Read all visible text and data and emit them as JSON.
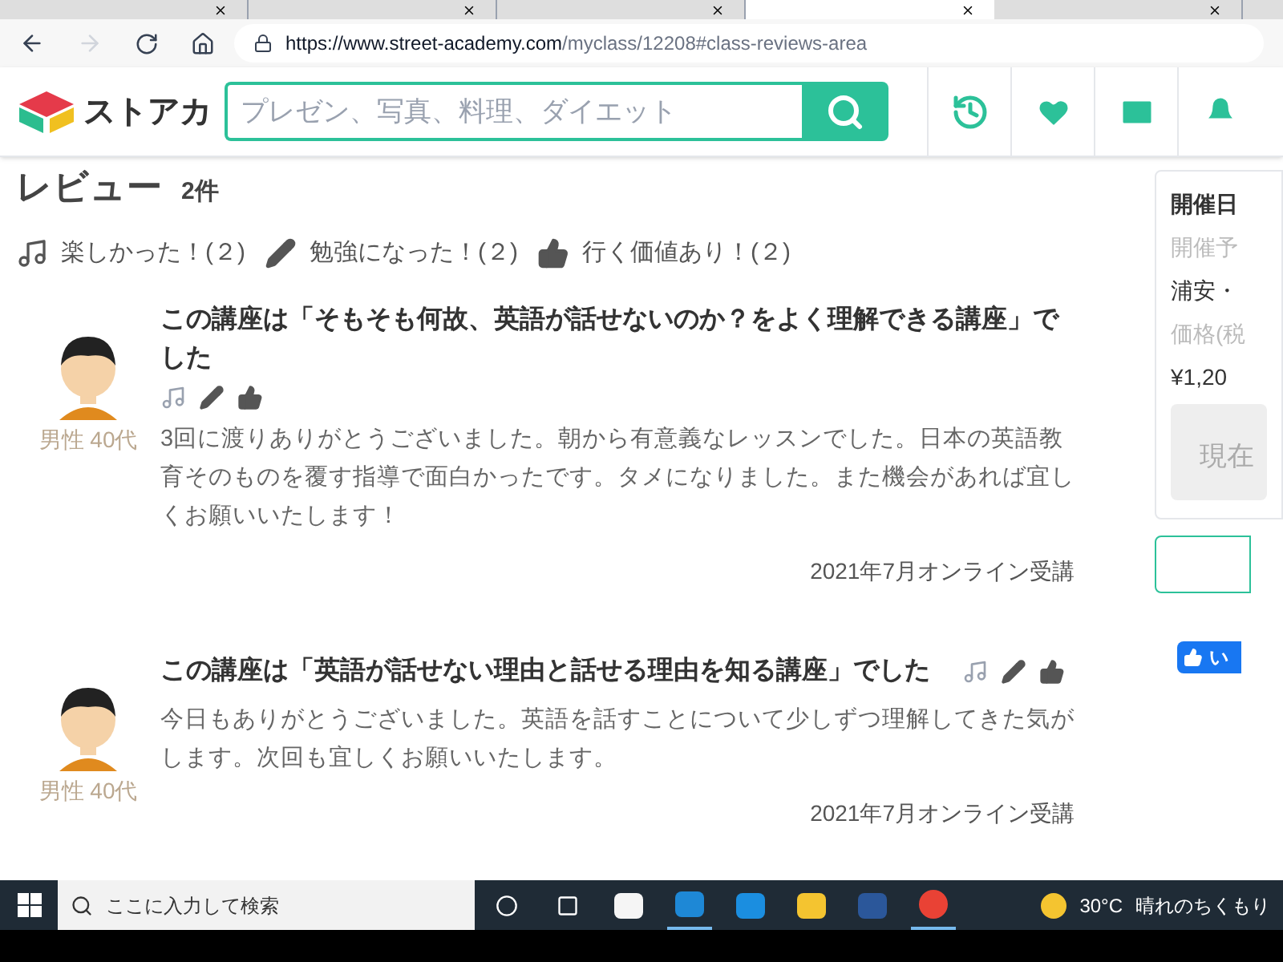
{
  "browser": {
    "tabs": [
      {
        "selected": false
      },
      {
        "selected": false
      },
      {
        "selected": false
      },
      {
        "selected": true
      },
      {
        "selected": false
      }
    ],
    "url_host": "https://www.street-academy.com",
    "url_path": "/myclass/12208#class-reviews-area"
  },
  "header": {
    "logo_text": "ストアカ",
    "search_placeholder": "プレゼン、写真、料理、ダイエット"
  },
  "reviews": {
    "title": "レビュー",
    "count": "2件",
    "summary": [
      {
        "kind": "music",
        "label": "楽しかった！(２)"
      },
      {
        "kind": "pencil",
        "label": "勉強になった！(２)"
      },
      {
        "kind": "thumb",
        "label": "行く価値あり！(２)"
      }
    ],
    "items": [
      {
        "reviewer": "男性 40代",
        "title": "この講座は「そもそも何故、英語が話せないのか？をよく理解できる講座」でした",
        "body": "3回に渡りありがとうございました。朝から有意義なレッスンでした。日本の英語教育そのものを覆す指導で面白かったです。タメになりました。また機会があれば宜しくお願いいたします！",
        "date": "2021年7月オンライン受講"
      },
      {
        "reviewer": "男性 40代",
        "title": "この講座は「英語が話せない理由と話せる理由を知る講座」でした",
        "body": "今日もありがとうございました。英語を話すことについて少しずつ理解してきた気がします。次回も宜しくお願いいたします。",
        "date": "2021年7月オンライン受講"
      }
    ]
  },
  "sidebar": {
    "heading": "開催日",
    "label_1": "開催予",
    "value_1": "浦安・",
    "label_2": "価格(税",
    "value_2": "¥1,20",
    "button": "現在",
    "like_button": "い"
  },
  "taskbar": {
    "search_placeholder": "ここに入力して検索",
    "temperature": "30°C",
    "weather": "晴れのちくもり"
  }
}
